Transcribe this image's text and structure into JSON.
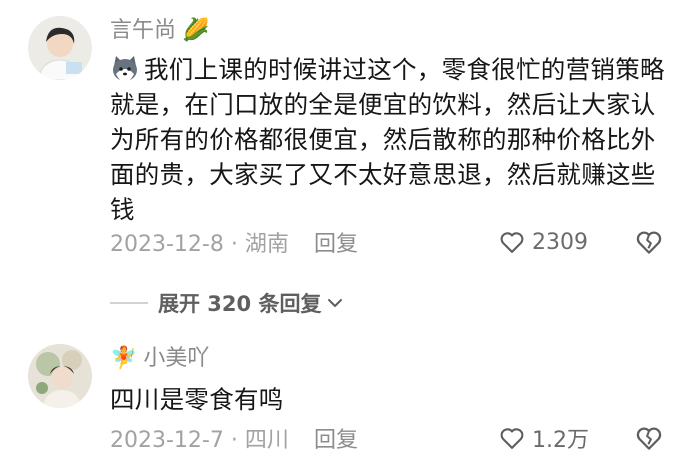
{
  "comments": [
    {
      "username": "言午尚",
      "name_emoji": "🌽",
      "inline_emoji": "husky-emoji",
      "text": "我们上课的时候讲过这个，零食很忙的营销策略就是，在门口放的全是便宜的饮料，然后让大家认为所有的价格都很便宜，然后散称的那种价格比外面的贵，大家买了又不太好意思退，然后就赚这些钱",
      "date_location": "2023-12-8 · 湖南",
      "reply_label": "回复",
      "like_count": "2309"
    },
    {
      "username": "小美吖",
      "name_emoji": "🧚",
      "text": "四川是零食有鸣",
      "date_location": "2023-12-7 · 四川",
      "reply_label": "回复",
      "like_count": "1.2万"
    }
  ],
  "expand_replies": {
    "label": "展开 320 条回复"
  },
  "colors": {
    "username": "#8a8a8a",
    "meta": "#a2a2a2",
    "text": "#161616"
  },
  "icons": [
    "heart-icon",
    "broken-heart-icon",
    "chevron-down-icon",
    "husky-emoji",
    "corn-emoji",
    "fairy-emoji"
  ]
}
